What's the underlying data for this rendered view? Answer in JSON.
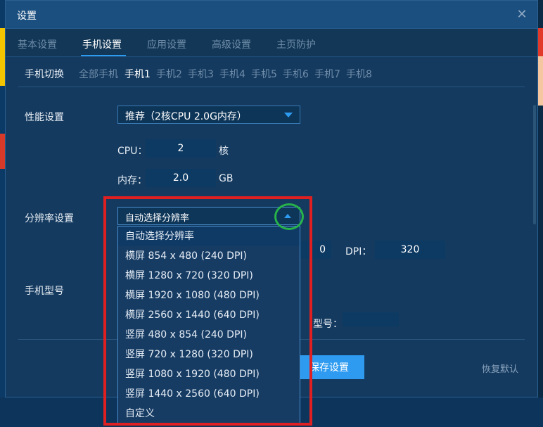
{
  "dialog": {
    "title": "设置",
    "close_icon": "close-icon"
  },
  "tabs": [
    "基本设置",
    "手机设置",
    "应用设置",
    "高级设置",
    "主页防护"
  ],
  "phone_switch": {
    "label": "手机切换",
    "items": [
      "全部手机",
      "手机1",
      "手机2",
      "手机3",
      "手机4",
      "手机5",
      "手机6",
      "手机7",
      "手机8"
    ],
    "active": "手机1"
  },
  "performance": {
    "label": "性能设置",
    "selected": "推荐（2核CPU 2.0G内存）",
    "cpu_label": "CPU：",
    "cpu_value": "2",
    "cpu_unit": "核",
    "mem_label": "内存：",
    "mem_value": "2.0",
    "mem_unit": "GB"
  },
  "resolution": {
    "label": "分辨率设置",
    "selected": "自动选择分辨率",
    "options": [
      "自动选择分辨率",
      "横屏  854 x  480 (240 DPI)",
      "横屏 1280 x  720 (320 DPI)",
      "横屏 1920 x 1080 (480 DPI)",
      "横屏 2560 x 1440 (640 DPI)",
      "竖屏  480 x  854 (240 DPI)",
      "竖屏  720 x 1280 (320 DPI)",
      "竖屏 1080 x 1920 (480 DPI)",
      "竖屏 1440 x 2560 (640 DPI)",
      "自定义"
    ],
    "partial_value": "0",
    "dpi_label": "DPI：",
    "dpi_value": "320"
  },
  "phone_model": {
    "label": "手机型号",
    "model_label": "型号：",
    "model_value": ""
  },
  "footer": {
    "save_label": "保存设置",
    "restore_label": "恢复默认"
  },
  "colors": {
    "accent": "#2e9bf0",
    "highlight_box": "#e02020",
    "highlight_circle": "#27b24a"
  }
}
